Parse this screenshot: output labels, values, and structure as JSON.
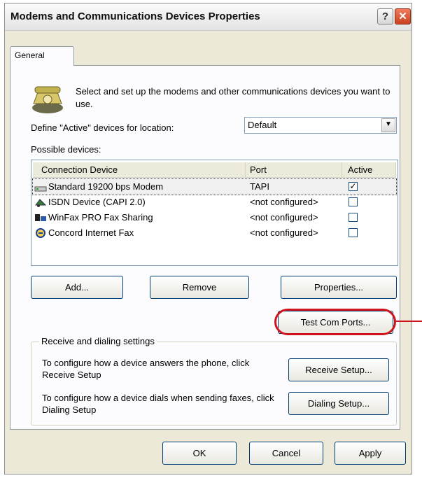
{
  "window": {
    "title": "Modems and Communications Devices Properties",
    "help_label": "?",
    "close_label": "✕"
  },
  "tabs": [
    {
      "label": "General"
    }
  ],
  "intro_text": "Select and set up the modems and other communications devices you want to use.",
  "location": {
    "label": "Define \"Active\" devices for location:",
    "value": "Default"
  },
  "devices_label": "Possible devices:",
  "table": {
    "columns": [
      "Connection Device",
      "Port",
      "Active"
    ],
    "rows": [
      {
        "device": "Standard 19200 bps Modem",
        "port": "TAPI",
        "active": true
      },
      {
        "device": "ISDN Device (CAPI 2.0)",
        "port": "<not configured>",
        "active": false
      },
      {
        "device": "WinFax PRO Fax Sharing",
        "port": "<not configured>",
        "active": false
      },
      {
        "device": "Concord Internet Fax",
        "port": "<not configured>",
        "active": false
      }
    ]
  },
  "buttons": {
    "add": "Add...",
    "remove": "Remove",
    "properties": "Properties...",
    "test_com_ports": "Test Com Ports..."
  },
  "receive_dialing": {
    "legend": "Receive and dialing settings",
    "receive_text": "To configure how a device answers the phone, click Receive Setup",
    "receive_button": "Receive Setup...",
    "dialing_text": "To configure how a device dials when sending faxes, click Dialing Setup",
    "dialing_button": "Dialing Setup..."
  },
  "footer": {
    "ok": "OK",
    "cancel": "Cancel",
    "apply": "Apply"
  },
  "colors": {
    "highlight": "#d0141d",
    "close_button": "#d9532f",
    "dialog_bg": "#ece9d8"
  },
  "icons": [
    "help-icon",
    "close-icon",
    "phone-icon",
    "modem-icon",
    "isdn-icon",
    "winfax-icon",
    "concord-fax-icon",
    "chevron-down-icon"
  ]
}
